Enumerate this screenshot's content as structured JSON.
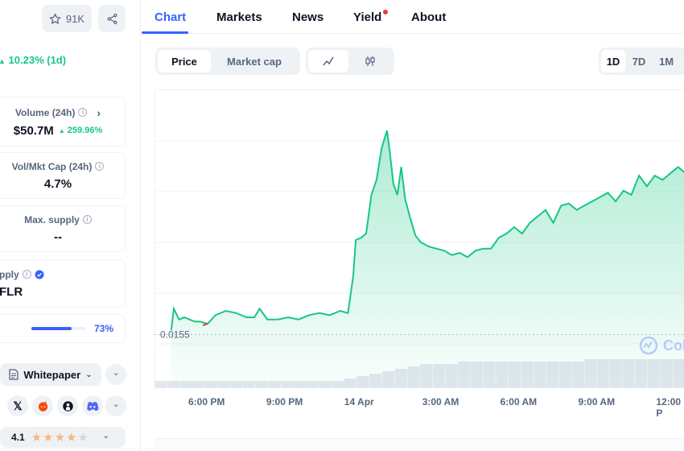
{
  "sidebar": {
    "watchlist_count": "91K",
    "price_change": "10.23% (1d)",
    "volume": {
      "label": "Volume (24h)",
      "value": "$50.7M",
      "change": "259.96%"
    },
    "vol_mkt_cap": {
      "label": "Vol/Mkt Cap (24h)",
      "value": "4.7%"
    },
    "max_supply": {
      "label": "Max. supply",
      "value": "--"
    },
    "supply": {
      "label": "pply",
      "value": "FLR"
    },
    "supply_progress": {
      "percent_label": "73%",
      "fraction": 0.73
    },
    "whitepaper_label": "Whitepaper",
    "rating": {
      "value": "4.1",
      "stars": 4.1
    }
  },
  "tabs": [
    {
      "label": "Chart",
      "active": true
    },
    {
      "label": "Markets"
    },
    {
      "label": "News"
    },
    {
      "label": "Yield",
      "badge": true
    },
    {
      "label": "About"
    }
  ],
  "chart_toggle": {
    "price": "Price",
    "market_cap": "Market cap"
  },
  "ranges": [
    "1D",
    "7D",
    "1M"
  ],
  "watermark": "Col",
  "colors": {
    "accent": "#3861fb",
    "green": "#16c784",
    "red": "#ea3943"
  },
  "chart_data": {
    "type": "area",
    "start_label": "0.0155",
    "x_ticks": [
      "6:00 PM",
      "9:00 PM",
      "14 Apr",
      "3:00 AM",
      "6:00 AM",
      "9:00 AM",
      "12:00 P"
    ],
    "x_hours": [
      0,
      3,
      6,
      9,
      12,
      15,
      18
    ],
    "series": [
      {
        "x": [
          -1.4,
          -1.3,
          -1.1,
          -0.9,
          -0.7,
          -0.5,
          -0.3,
          0,
          0.3,
          0.7,
          1.1,
          1.5,
          1.8,
          2.0,
          2.3,
          2.7,
          3.1,
          3.5,
          3.9,
          4.3,
          4.7,
          5.1,
          5.4,
          5.6,
          5.7,
          5.9,
          6.1,
          6.3,
          6.5,
          6.7,
          6.9,
          7.0,
          7.15,
          7.3,
          7.45,
          7.6,
          7.8,
          8.0,
          8.2,
          8.5,
          8.8,
          9.1,
          9.4,
          9.7,
          10.0,
          10.3,
          10.6,
          10.9,
          11.2,
          11.5,
          11.8,
          12.1,
          12.4,
          12.7,
          13.0,
          13.3,
          13.6,
          13.9,
          14.2,
          14.5,
          14.8,
          15.1,
          15.4,
          15.7,
          16.0,
          16.3,
          16.6,
          16.9,
          17.2,
          17.5,
          17.8,
          18.1,
          18.4
        ],
        "y": [
          0.01552,
          0.01562,
          0.01557,
          0.01558,
          0.01557,
          0.01556,
          0.01556,
          0.01555,
          0.01559,
          0.01561,
          0.0156,
          0.01558,
          0.01558,
          0.01562,
          0.01557,
          0.01557,
          0.01558,
          0.01557,
          0.01559,
          0.0156,
          0.01559,
          0.01561,
          0.0156,
          0.01577,
          0.01594,
          0.01595,
          0.01597,
          0.01615,
          0.01622,
          0.01637,
          0.01645,
          0.01636,
          0.0162,
          0.01615,
          0.01628,
          0.01613,
          0.01604,
          0.01596,
          0.01593,
          0.01591,
          0.0159,
          0.01589,
          0.01587,
          0.01588,
          0.01586,
          0.01589,
          0.0159,
          0.0159,
          0.01595,
          0.01597,
          0.016,
          0.01597,
          0.01602,
          0.01605,
          0.01608,
          0.01602,
          0.0161,
          0.01611,
          0.01608,
          0.0161,
          0.01612,
          0.01614,
          0.01616,
          0.01612,
          0.01617,
          0.01615,
          0.01624,
          0.01619,
          0.01624,
          0.01622,
          0.01625,
          0.01628,
          0.01625
        ]
      }
    ],
    "ylim": [
      0.0154,
      0.0166
    ],
    "volume": [
      3,
      3,
      3,
      3,
      3,
      3,
      3,
      3,
      3,
      3,
      3,
      3,
      3,
      3,
      3,
      4,
      5,
      6,
      7,
      8,
      9,
      10,
      10,
      10,
      11,
      11,
      11,
      11,
      11,
      11,
      11,
      11,
      11,
      11,
      12,
      12,
      12,
      12,
      12,
      12,
      12,
      12
    ]
  }
}
